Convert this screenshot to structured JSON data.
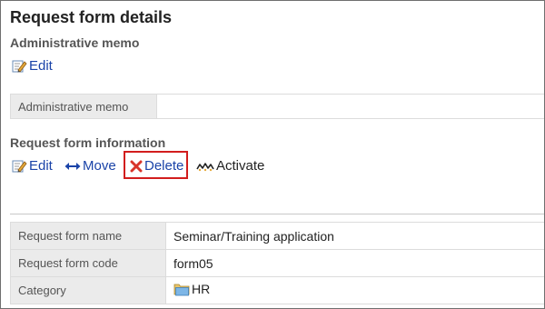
{
  "page": {
    "title": "Request form details"
  },
  "admin_memo": {
    "section_title": "Administrative memo",
    "edit_label": "Edit",
    "table_label": "Administrative memo",
    "table_value": ""
  },
  "form_info": {
    "section_title": "Request form information",
    "actions": {
      "edit_label": "Edit",
      "move_label": "Move",
      "delete_label": "Delete",
      "activate_label": "Activate"
    },
    "rows": [
      {
        "label": "Request form name",
        "value": "Seminar/Training application"
      },
      {
        "label": "Request form code",
        "value": "form05"
      },
      {
        "label": "Category",
        "value": "HR"
      }
    ]
  },
  "colors": {
    "link": "#1a43a8",
    "highlight": "#d21d1d",
    "label_bg": "#ebebeb"
  }
}
